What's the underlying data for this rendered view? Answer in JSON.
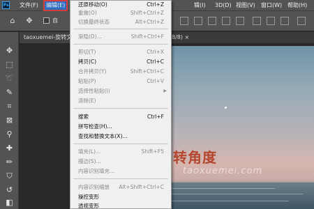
{
  "menubar": {
    "logo": "Ps",
    "items": [
      "文件(F)",
      "编辑(E)",
      "辑(I)",
      "3D(D)",
      "视图(V)",
      "窗口(W)",
      "帮助(H)"
    ]
  },
  "options_bar": {
    "auto_select_label": "自"
  },
  "document": {
    "tab_title": "taoxuemei-旋转文",
    "tab_suffix": "8/8) ×"
  },
  "canvas": {
    "title_text": "转角度",
    "watermark": "taoxuemei.com"
  },
  "edit_menu": {
    "items": [
      {
        "label": "还原移动(O)",
        "shortcut": "Ctrl+Z",
        "enabled": true
      },
      {
        "label": "重做(O)",
        "shortcut": "Shift+Ctrl+Z",
        "enabled": false
      },
      {
        "label": "切换最终状态",
        "shortcut": "Alt+Ctrl+Z",
        "enabled": false
      },
      {
        "label": "渐隐(D)...",
        "shortcut": "Shift+Ctrl+F",
        "enabled": false
      },
      {
        "label": "剪切(T)",
        "shortcut": "Ctrl+X",
        "enabled": false
      },
      {
        "label": "拷贝(C)",
        "shortcut": "Ctrl+C",
        "enabled": true
      },
      {
        "label": "合并拷贝(Y)",
        "shortcut": "Shift+Ctrl+C",
        "enabled": false
      },
      {
        "label": "粘贴(P)",
        "shortcut": "Ctrl+V",
        "enabled": false
      },
      {
        "label": "选择性粘贴(I)",
        "shortcut": "",
        "enabled": false,
        "submenu": true
      },
      {
        "label": "清除(E)",
        "shortcut": "",
        "enabled": false
      },
      {
        "label": "搜索",
        "shortcut": "Ctrl+F",
        "enabled": true
      },
      {
        "label": "拼写检查(H)...",
        "shortcut": "",
        "enabled": true
      },
      {
        "label": "查找和替换文本(X)...",
        "shortcut": "",
        "enabled": true
      },
      {
        "label": "填充(L)...",
        "shortcut": "Shift+F5",
        "enabled": false
      },
      {
        "label": "描边(S)...",
        "shortcut": "",
        "enabled": false
      },
      {
        "label": "内容识别填充...",
        "shortcut": "",
        "enabled": false
      },
      {
        "label": "内容识别缩放",
        "shortcut": "Alt+Shift+Ctrl+C",
        "enabled": false
      },
      {
        "label": "操控变形",
        "shortcut": "",
        "enabled": true
      },
      {
        "label": "透视变形",
        "shortcut": "",
        "enabled": true
      }
    ],
    "submenu_arrow": "▶"
  },
  "colors": {
    "menubar_bg": "#535353",
    "active_menu_bg": "#2d6ec3",
    "highlight_border": "#d53c3c",
    "menu_bg": "#f0f0f0",
    "canvas_text": "#b5462e"
  }
}
